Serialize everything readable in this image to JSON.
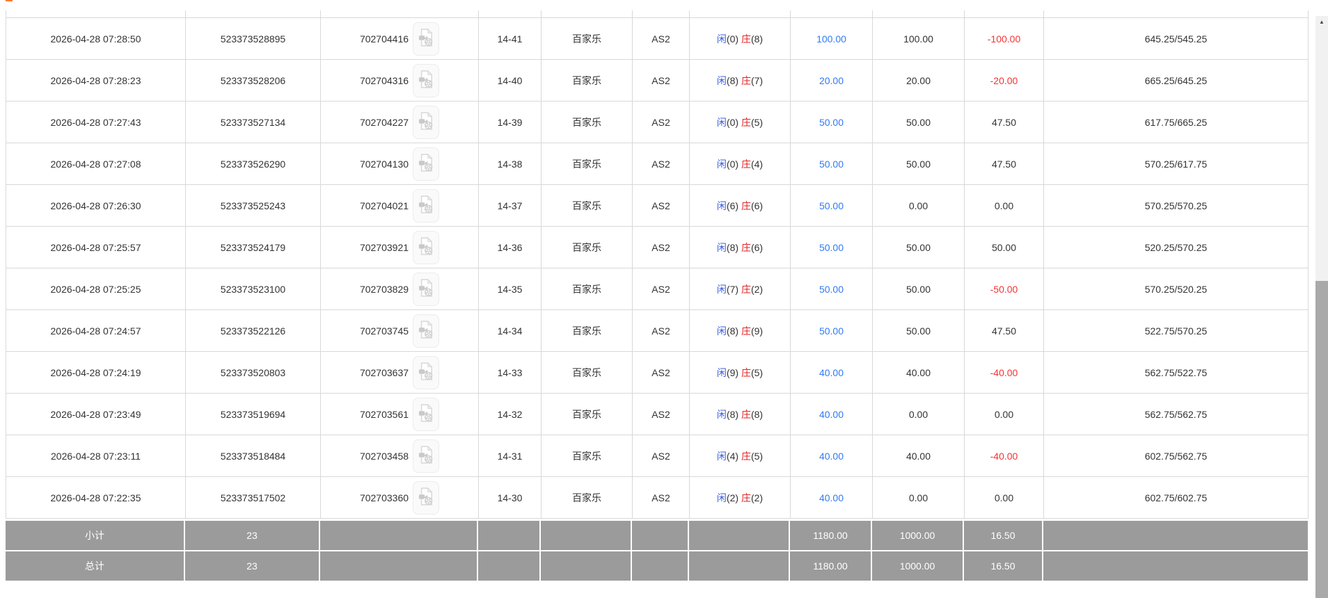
{
  "table": {
    "rows": [
      {
        "bet_time": "2026-04-28 07:28:50",
        "order_id": "523373528895",
        "game_id": "702704416",
        "round": "14-41",
        "game_name": "百家乐",
        "table_name": "AS2",
        "player_label": "闲",
        "player_score": "(0)",
        "banker_label": "庄",
        "banker_score": "(8)",
        "bet_amount": "100.00",
        "valid_amount": "100.00",
        "win_loss": "-100.00",
        "balance": "645.25/545.25"
      },
      {
        "bet_time": "2026-04-28 07:28:23",
        "order_id": "523373528206",
        "game_id": "702704316",
        "round": "14-40",
        "game_name": "百家乐",
        "table_name": "AS2",
        "player_label": "闲",
        "player_score": "(8)",
        "banker_label": "庄",
        "banker_score": "(7)",
        "bet_amount": "20.00",
        "valid_amount": "20.00",
        "win_loss": "-20.00",
        "balance": "665.25/645.25"
      },
      {
        "bet_time": "2026-04-28 07:27:43",
        "order_id": "523373527134",
        "game_id": "702704227",
        "round": "14-39",
        "game_name": "百家乐",
        "table_name": "AS2",
        "player_label": "闲",
        "player_score": "(0)",
        "banker_label": "庄",
        "banker_score": "(5)",
        "bet_amount": "50.00",
        "valid_amount": "50.00",
        "win_loss": "47.50",
        "balance": "617.75/665.25"
      },
      {
        "bet_time": "2026-04-28 07:27:08",
        "order_id": "523373526290",
        "game_id": "702704130",
        "round": "14-38",
        "game_name": "百家乐",
        "table_name": "AS2",
        "player_label": "闲",
        "player_score": "(0)",
        "banker_label": "庄",
        "banker_score": "(4)",
        "bet_amount": "50.00",
        "valid_amount": "50.00",
        "win_loss": "47.50",
        "balance": "570.25/617.75"
      },
      {
        "bet_time": "2026-04-28 07:26:30",
        "order_id": "523373525243",
        "game_id": "702704021",
        "round": "14-37",
        "game_name": "百家乐",
        "table_name": "AS2",
        "player_label": "闲",
        "player_score": "(6)",
        "banker_label": "庄",
        "banker_score": "(6)",
        "bet_amount": "50.00",
        "valid_amount": "0.00",
        "win_loss": "0.00",
        "balance": "570.25/570.25"
      },
      {
        "bet_time": "2026-04-28 07:25:57",
        "order_id": "523373524179",
        "game_id": "702703921",
        "round": "14-36",
        "game_name": "百家乐",
        "table_name": "AS2",
        "player_label": "闲",
        "player_score": "(8)",
        "banker_label": "庄",
        "banker_score": "(6)",
        "bet_amount": "50.00",
        "valid_amount": "50.00",
        "win_loss": "50.00",
        "balance": "520.25/570.25"
      },
      {
        "bet_time": "2026-04-28 07:25:25",
        "order_id": "523373523100",
        "game_id": "702703829",
        "round": "14-35",
        "game_name": "百家乐",
        "table_name": "AS2",
        "player_label": "闲",
        "player_score": "(7)",
        "banker_label": "庄",
        "banker_score": "(2)",
        "bet_amount": "50.00",
        "valid_amount": "50.00",
        "win_loss": "-50.00",
        "balance": "570.25/520.25"
      },
      {
        "bet_time": "2026-04-28 07:24:57",
        "order_id": "523373522126",
        "game_id": "702703745",
        "round": "14-34",
        "game_name": "百家乐",
        "table_name": "AS2",
        "player_label": "闲",
        "player_score": "(8)",
        "banker_label": "庄",
        "banker_score": "(9)",
        "bet_amount": "50.00",
        "valid_amount": "50.00",
        "win_loss": "47.50",
        "balance": "522.75/570.25"
      },
      {
        "bet_time": "2026-04-28 07:24:19",
        "order_id": "523373520803",
        "game_id": "702703637",
        "round": "14-33",
        "game_name": "百家乐",
        "table_name": "AS2",
        "player_label": "闲",
        "player_score": "(9)",
        "banker_label": "庄",
        "banker_score": "(5)",
        "bet_amount": "40.00",
        "valid_amount": "40.00",
        "win_loss": "-40.00",
        "balance": "562.75/522.75"
      },
      {
        "bet_time": "2026-04-28 07:23:49",
        "order_id": "523373519694",
        "game_id": "702703561",
        "round": "14-32",
        "game_name": "百家乐",
        "table_name": "AS2",
        "player_label": "闲",
        "player_score": "(8)",
        "banker_label": "庄",
        "banker_score": "(8)",
        "bet_amount": "40.00",
        "valid_amount": "0.00",
        "win_loss": "0.00",
        "balance": "562.75/562.75"
      },
      {
        "bet_time": "2026-04-28 07:23:11",
        "order_id": "523373518484",
        "game_id": "702703458",
        "round": "14-31",
        "game_name": "百家乐",
        "table_name": "AS2",
        "player_label": "闲",
        "player_score": "(4)",
        "banker_label": "庄",
        "banker_score": "(5)",
        "bet_amount": "40.00",
        "valid_amount": "40.00",
        "win_loss": "-40.00",
        "balance": "602.75/562.75"
      },
      {
        "bet_time": "2026-04-28 07:22:35",
        "order_id": "523373517502",
        "game_id": "702703360",
        "round": "14-30",
        "game_name": "百家乐",
        "table_name": "AS2",
        "player_label": "闲",
        "player_score": "(2)",
        "banker_label": "庄",
        "banker_score": "(2)",
        "bet_amount": "40.00",
        "valid_amount": "0.00",
        "win_loss": "0.00",
        "balance": "602.75/602.75"
      }
    ]
  },
  "summary_rows": [
    {
      "label": "小计",
      "count": "23",
      "bet_total": "1180.00",
      "valid_total": "1000.00",
      "win_loss_total": "16.50"
    },
    {
      "label": "总计",
      "count": "23",
      "bet_total": "1180.00",
      "valid_total": "1000.00",
      "win_loss_total": "16.50"
    }
  ],
  "scrollbar": {
    "up_arrow": "▲"
  },
  "colors": {
    "player_blue": "#3a5fdd",
    "banker_red": "#e02222",
    "amount_link_blue": "#2f7bf5",
    "negative_red": "#f53333",
    "summary_gray": "#9b9b9b",
    "border_gray": "#d8d8d8"
  }
}
